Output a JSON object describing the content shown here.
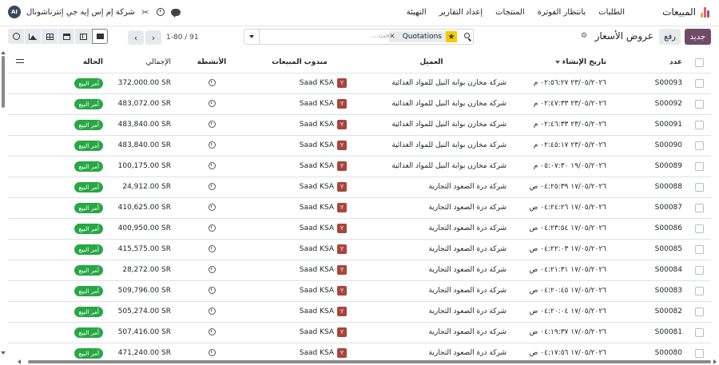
{
  "navbar": {
    "app_title": "المبيعات",
    "menus": [
      "الطلبات",
      "بانتظار الفوترة",
      "المنتجات",
      "إعداد التقارير",
      "التهيئة"
    ],
    "company": "شركة إم إس إيه جي إنترناشونال",
    "avatar_initials": "AI"
  },
  "control": {
    "new_label": "جديد",
    "upload_label": "رفع",
    "breadcrumb": "عروض الأسعار",
    "search": {
      "facet_label": "Quotations",
      "placeholder": "بحث..."
    },
    "pager": {
      "value": "1-80 / 91"
    }
  },
  "table": {
    "headers": {
      "number": "عدد",
      "date": "تاريخ الإنشاء",
      "customer": "العميل",
      "salesperson": "مندوب المبيعات",
      "activities": "الأنشطة",
      "total": "الإجمالي",
      "status": "الحالة"
    },
    "rows": [
      {
        "number": "S00093",
        "date": "٢٣/٠٥/٢٠٢٦ ٠٢:٥٦:٢٧ م",
        "customer": "شركة مخازن بوابة النيل للمواد الغذائية",
        "sp_initial": "Y",
        "salesperson": "Saad KSA",
        "total": "372,000.00 SR",
        "status": "أمر البيع"
      },
      {
        "number": "S00092",
        "date": "٢٣/٠٥/٢٠٢٦ ٠٢:٤٧:٣٣ م",
        "customer": "شركة مخازن بوابة النيل للمواد الغذائية",
        "sp_initial": "Y",
        "salesperson": "Saad KSA",
        "total": "483,072.00 SR",
        "status": "أمر البيع"
      },
      {
        "number": "S00091",
        "date": "٢٣/٠٥/٢٠٢٦ ٠٢:٤٦:٣٣ م",
        "customer": "شركة مخازن بوابة النيل للمواد الغذائية",
        "sp_initial": "Y",
        "salesperson": "Saad KSA",
        "total": "483,840.00 SR",
        "status": "أمر البيع"
      },
      {
        "number": "S00090",
        "date": "٢٣/٠٥/٢٠٢٦ ٠٢:٤٥:١٧ م",
        "customer": "شركة مخازن بوابة النيل للمواد الغذائية",
        "sp_initial": "Y",
        "salesperson": "Saad KSA",
        "total": "483,840.00 SR",
        "status": "أمر البيع"
      },
      {
        "number": "S00089",
        "date": "١٩/٠٥/٢٠٢٦ ٠٥:٠٧:٣٠ م",
        "customer": "شركة مخازن بوابة النيل للمواد الغذائية",
        "sp_initial": "Y",
        "salesperson": "Saad KSA",
        "total": "100,175.00 SR",
        "status": "أمر البيع"
      },
      {
        "number": "S00088",
        "date": "١٧/٠٥/٢٠٢٦ ٠٤:٢٥:٣٩ ص",
        "customer": "شركة درة الصعود التجارية",
        "sp_initial": "Y",
        "salesperson": "Saad KSA",
        "total": "24,912.00 SR",
        "status": "أمر البيع"
      },
      {
        "number": "S00087",
        "date": "١٧/٠٥/٢٠٢٦ ٠٤:٢٤:٢٦ ص",
        "customer": "شركة درة الصعود التجارية",
        "sp_initial": "Y",
        "salesperson": "Saad KSA",
        "total": "410,625.00 SR",
        "status": "أمر البيع"
      },
      {
        "number": "S00086",
        "date": "١٧/٠٥/٢٠٢٦ ٠٤:٢٣:٥٤ ص",
        "customer": "شركة درة الصعود التجارية",
        "sp_initial": "Y",
        "salesperson": "Saad KSA",
        "total": "400,950.00 SR",
        "status": "أمر البيع"
      },
      {
        "number": "S00085",
        "date": "١٧/٠٥/٢٠٢٦ ٠٤:٢٢:٠٣ ص",
        "customer": "شركة درة الصعود التجارية",
        "sp_initial": "Y",
        "salesperson": "Saad KSA",
        "total": "415,575.00 SR",
        "status": "أمر البيع"
      },
      {
        "number": "S00084",
        "date": "١٧/٠٥/٢٠٢٦ ٠٤:٢١:٣١ ص",
        "customer": "شركة درة الصعود التجارية",
        "sp_initial": "Y",
        "salesperson": "Saad KSA",
        "total": "28,272.00 SR",
        "status": "أمر البيع"
      },
      {
        "number": "S00083",
        "date": "١٧/٠٥/٢٠٢٦ ٠٤:٢٠:٤٥ ص",
        "customer": "شركة درة الصعود التجارية",
        "sp_initial": "Y",
        "salesperson": "Saad KSA",
        "total": "509,796.00 SR",
        "status": "أمر البيع"
      },
      {
        "number": "S00082",
        "date": "١٧/٠٥/٢٠٢٦ ٠٤:٢٠:٠٤ ص",
        "customer": "شركة درة الصعود التجارية",
        "sp_initial": "Y",
        "salesperson": "Saad KSA",
        "total": "505,274.00 SR",
        "status": "أمر البيع"
      },
      {
        "number": "S00081",
        "date": "١٧/٠٥/٢٠٢٦ ٠٤:١٩:٣٧ ص",
        "customer": "شركة درة الصعود التجارية",
        "sp_initial": "Y",
        "salesperson": "Saad KSA",
        "total": "507,416.00 SR",
        "status": "أمر البيع"
      },
      {
        "number": "S00080",
        "date": "١٧/٠٥/٢٠٢٦ ٠٤:١٧:٥٦ ص",
        "customer": "شركة درة الصعود التجارية",
        "sp_initial": "Y",
        "salesperson": "Saad KSA",
        "total": "471,240.00 SR",
        "status": "أمر البيع"
      }
    ]
  },
  "colors": {
    "primary": "#714b67",
    "status_badge": "#28a745",
    "salesperson_avatar": "#a8453c"
  }
}
